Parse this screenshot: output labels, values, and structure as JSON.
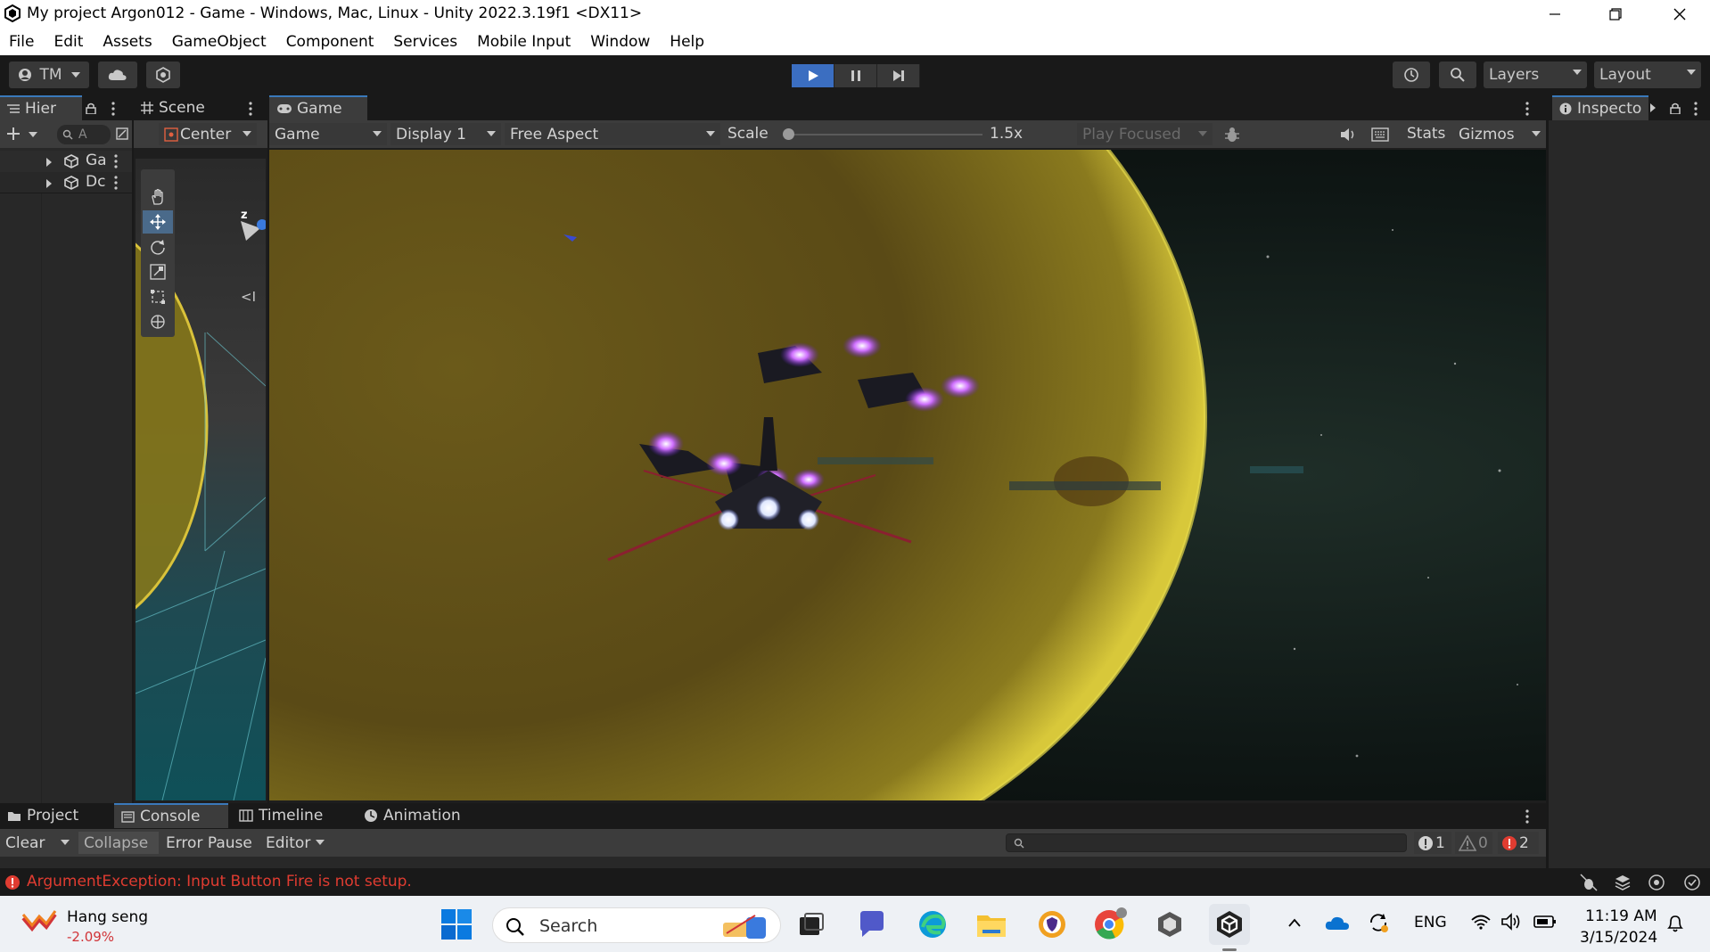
{
  "window": {
    "title": "My project Argon012 - Game - Windows, Mac, Linux - Unity 2022.3.19f1 <DX11>"
  },
  "menu": [
    "File",
    "Edit",
    "Assets",
    "GameObject",
    "Component",
    "Services",
    "Mobile Input",
    "Window",
    "Help"
  ],
  "toolbar": {
    "account": "TM",
    "layers": "Layers",
    "layout": "Layout"
  },
  "hierarchy": {
    "tab": "Hier",
    "search_placeholder": "A",
    "items": [
      "Ga",
      "Dc"
    ]
  },
  "scene": {
    "tab": "Scene",
    "pivot": "Center",
    "gizmo_axis": "z",
    "back_label": "<I"
  },
  "game": {
    "tab": "Game",
    "view_mode": "Game",
    "display": "Display 1",
    "aspect": "Free Aspect",
    "scale_label": "Scale",
    "scale_value": "1.5x",
    "scale_fraction": 0.0,
    "play_mode": "Play Focused",
    "stats": "Stats",
    "gizmos": "Gizmos"
  },
  "inspector": {
    "tab": "Inspecto"
  },
  "console": {
    "tabs": [
      "Project",
      "Console",
      "Timeline",
      "Animation"
    ],
    "clear": "Clear",
    "collapse": "Collapse",
    "error_pause": "Error Pause",
    "editor": "Editor",
    "count_info": "1",
    "count_warn": "0",
    "count_error": "2",
    "status_message": "ArgumentException: Input Button Fire is not setup."
  },
  "taskbar": {
    "stock_name": "Hang seng",
    "stock_change": "-2.09%",
    "search": "Search",
    "language": "ENG",
    "time": "11:19 AM",
    "date": "3/15/2024"
  },
  "colors": {
    "accent": "#3a79bb",
    "play_active": "#3b6ec1",
    "error": "#e03c31",
    "stock_down": "#d13438"
  }
}
